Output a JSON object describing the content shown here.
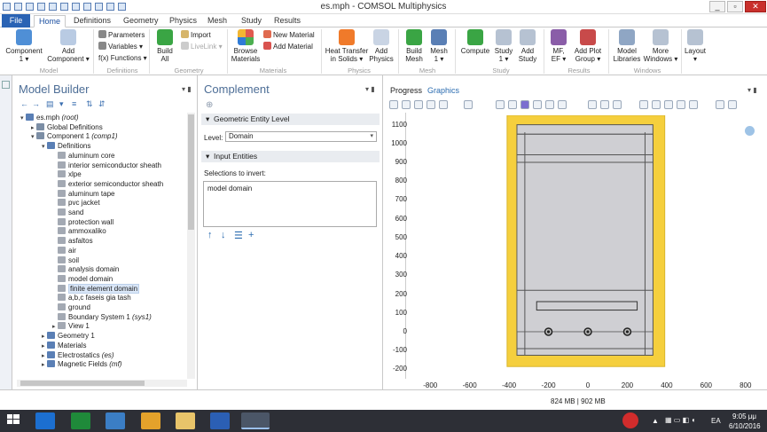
{
  "window": {
    "title": "es.mph - COMSOL Multiphysics"
  },
  "ribbon_tabs": [
    "File",
    "Home",
    "Definitions",
    "Geometry",
    "Physics",
    "Mesh",
    "Study",
    "Results"
  ],
  "ribbon": {
    "component": "Component\n1 ▾",
    "add_component": "Add\nComponent ▾",
    "parameters": "Parameters",
    "variables": "Variables ▾",
    "functions": "f(x) Functions ▾",
    "build_all": "Build\nAll",
    "import": "Import",
    "livelink": "LiveLink ▾",
    "browse_materials": "Browse\nMaterials",
    "new_material": "New Material",
    "add_material": "Add Material",
    "heat_transfer": "Heat Transfer\nin Solids ▾",
    "add_physics": "Add\nPhysics",
    "build_mesh": "Build\nMesh",
    "mesh": "Mesh\n1 ▾",
    "compute": "Compute",
    "study": "Study\n1 ▾",
    "add_study": "Add\nStudy",
    "mf_ef": "MF,\nEF ▾",
    "add_plot_group": "Add Plot\nGroup ▾",
    "model_libraries": "Model\nLibraries",
    "more_windows": "More\nWindows ▾",
    "layout": "Layout\n▾",
    "groups": {
      "model": "Model",
      "definitions": "Definitions",
      "geometry": "Geometry",
      "materials": "Materials",
      "physics": "Physics",
      "mesh": "Mesh",
      "study": "Study",
      "results": "Results",
      "windows": "Windows"
    }
  },
  "model_builder": {
    "title": "Model Builder",
    "tree": [
      {
        "label": "es.mph",
        "suffix": "(root)",
        "level": 0,
        "toggle": "▾"
      },
      {
        "label": "Global Definitions",
        "level": 1,
        "toggle": "▸"
      },
      {
        "label": "Component 1",
        "suffix": "(comp1)",
        "level": 1,
        "toggle": "▾"
      },
      {
        "label": "Definitions",
        "level": 2,
        "toggle": "▾"
      },
      {
        "label": "aluminum core",
        "level": 3
      },
      {
        "label": "interior semiconductor sheath",
        "level": 3
      },
      {
        "label": "xlpe",
        "level": 3
      },
      {
        "label": "exterior semiconductor sheath",
        "level": 3
      },
      {
        "label": "aluminum tape",
        "level": 3
      },
      {
        "label": "pvc jacket",
        "level": 3
      },
      {
        "label": "sand",
        "level": 3
      },
      {
        "label": "protection wall",
        "level": 3
      },
      {
        "label": "ammoxaliko",
        "level": 3
      },
      {
        "label": "asfaltos",
        "level": 3
      },
      {
        "label": "air",
        "level": 3
      },
      {
        "label": "soil",
        "level": 3
      },
      {
        "label": "analysis domain",
        "level": 3
      },
      {
        "label": "model domain",
        "level": 3
      },
      {
        "label": "finite element domain",
        "level": 3,
        "selected": true
      },
      {
        "label": "a,b,c faseis gia tash",
        "level": 3
      },
      {
        "label": "ground",
        "level": 3
      },
      {
        "label": "Boundary System 1",
        "suffix": "(sys1)",
        "level": 3
      },
      {
        "label": "View 1",
        "level": 3,
        "toggle": "▸"
      },
      {
        "label": "Geometry 1",
        "level": 2,
        "toggle": "▸"
      },
      {
        "label": "Materials",
        "level": 2,
        "toggle": "▸"
      },
      {
        "label": "Electrostatics",
        "suffix": "(es)",
        "level": 2,
        "toggle": "▸"
      },
      {
        "label": "Magnetic Fields",
        "suffix": "(mf)",
        "level": 2,
        "toggle": "▸"
      }
    ]
  },
  "settings": {
    "title": "Complement",
    "section_geometric": "Geometric Entity Level",
    "level_label": "Level:",
    "level_value": "Domain",
    "section_input": "Input Entities",
    "selections_label": "Selections to invert:",
    "selections": [
      "model domain"
    ]
  },
  "graphics": {
    "tabs": [
      "Progress",
      "Graphics"
    ],
    "active_tab": "Graphics",
    "memory": "824 MB | 902 MB"
  },
  "chart_data": {
    "type": "scatter",
    "title": "",
    "xlabel": "",
    "ylabel": "",
    "xlim": [
      -900,
      900
    ],
    "ylim": [
      -250,
      1150
    ],
    "x_ticks": [
      -800,
      -600,
      -400,
      -200,
      0,
      200,
      400,
      600,
      800
    ],
    "y_ticks": [
      1100,
      1000,
      900,
      800,
      700,
      600,
      500,
      400,
      300,
      200,
      100,
      0,
      -100,
      -200
    ],
    "series": [
      {
        "x": [
          -200,
          0,
          200
        ],
        "y": [
          0,
          0,
          0
        ]
      }
    ]
  },
  "taskbar": {
    "time": "9:05 μμ",
    "date": "6/10/2016",
    "lang": "EA"
  },
  "colors": {
    "accent": "#2a63b4",
    "yellow": "#f5cf3d",
    "selection": "#d9e6f7"
  }
}
